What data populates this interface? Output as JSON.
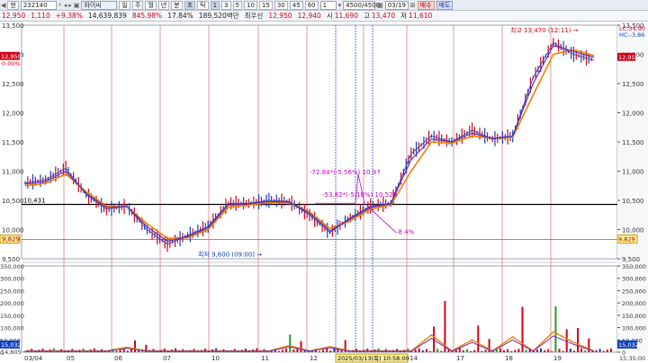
{
  "toolbar": {
    "mode_label": "현",
    "code": "232140",
    "name": "와이씨",
    "periods": [
      "일",
      "주",
      "월",
      "년",
      "분",
      "초",
      "틱"
    ],
    "intervals": [
      "1",
      "3",
      "5",
      "10",
      "15",
      "30",
      "45",
      "60"
    ],
    "count_sel": "1",
    "range": "4500/4500",
    "date": "03/19",
    "buy_label": "매수",
    "sell_label": "매도"
  },
  "info": {
    "price": "12,950",
    "change": "1,110",
    "change_pct": "+9.38%",
    "volume": "14,639,839",
    "turnover_pct": "845.98%",
    "ratio": "17.84%",
    "amount": "189,520백만",
    "prev_label": "최우선",
    "bid": "12,950",
    "ask": "12,940",
    "high_label": "시",
    "open": "11,690",
    "hi_label": "고",
    "high": "13,470",
    "low_label": "저",
    "low": "11,610"
  },
  "colors": {
    "up": "#d0021b",
    "down": "#1040c0",
    "ma_orange": "#f08000",
    "ma_purple": "#6a2bb0",
    "ann": "#c000c0"
  },
  "chart_data": [
    {
      "type": "line",
      "title": "",
      "series_kind": "price-candles-with-moving-averages",
      "x": [
        "03/04",
        "05",
        "06",
        "07",
        "10",
        "11",
        "12",
        "13",
        "14",
        "17",
        "18",
        "19"
      ],
      "ylim": [
        9500,
        13500
      ],
      "yticks": [
        "13,500",
        "13,000",
        "12,500",
        "12,000",
        "11,500",
        "11,000",
        "10,500",
        "10,000",
        "9,500"
      ],
      "close": [
        10800,
        10850,
        11050,
        10600,
        10350,
        10400,
        10000,
        9750,
        9900,
        10050,
        10450,
        10450,
        10500,
        10480,
        10250,
        9950,
        10200,
        10400,
        10450,
        11300,
        11600,
        11500,
        11700,
        11550,
        11600,
        12600,
        13200,
        13000,
        12900
      ],
      "ma_fast": [
        10780,
        10820,
        11000,
        10620,
        10380,
        10400,
        10050,
        9800,
        9880,
        10030,
        10420,
        10440,
        10480,
        10470,
        10280,
        9980,
        10180,
        10380,
        10440,
        11200,
        11550,
        11500,
        11650,
        11560,
        11600,
        12500,
        13150,
        13050,
        12950
      ],
      "ma_slow": [
        10750,
        10790,
        10950,
        10650,
        10400,
        10390,
        10100,
        9850,
        9860,
        10000,
        10380,
        10420,
        10460,
        10460,
        10300,
        10020,
        10150,
        10350,
        10420,
        11000,
        11500,
        11480,
        11600,
        11560,
        11580,
        12300,
        13000,
        13080,
        12980
      ],
      "reference_line": {
        "value": 10431,
        "label": "10,431"
      },
      "last_label": "12,950",
      "prev_label": "0.00%",
      "cursor_label": "9,829",
      "lc": "LC:34.90",
      "hc": "HC:-3.86",
      "annotations": {
        "high": "최고 13,470 (12:11)",
        "low": "최저 9,600 (09:00)",
        "delta1": "-72.84*(-5.56%) 10.9↑",
        "delta2": "-53.82*(-5.10%) 10,526",
        "delta3": "-8.4%"
      }
    },
    {
      "type": "bar",
      "title": "",
      "series_kind": "volume",
      "ylim": [
        0,
        350000
      ],
      "yticks": [
        "350,000",
        "300,000",
        "250,000",
        "200,000",
        "150,000",
        "100,000",
        "50,000",
        "0"
      ],
      "last_label": "15,032",
      "sub_label": "14,605",
      "cursor_date": "2025/03/13(목) 10:58:00"
    }
  ],
  "time_label": "15:35:00"
}
